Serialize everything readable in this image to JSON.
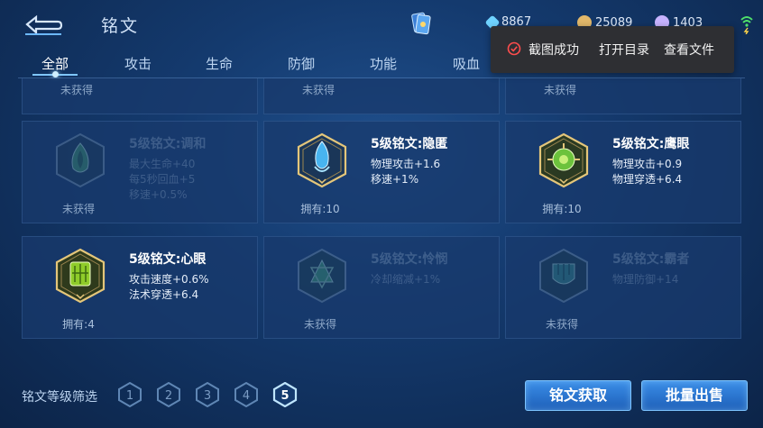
{
  "header": {
    "title": "铭文",
    "currency": [
      {
        "icon": "diamond-icon",
        "value": "8867",
        "color": "#6fd3ff"
      },
      {
        "icon": "gold-coin-icon",
        "value": "25089",
        "color": "#e2b86a"
      },
      {
        "icon": "gem-icon",
        "value": "1403",
        "color": "#c7b3ff"
      }
    ]
  },
  "tabs": [
    "全部",
    "攻击",
    "生命",
    "防御",
    "功能",
    "吸血"
  ],
  "toast": {
    "message": "截图成功",
    "open_dir": "打开目录",
    "view_file": "查看文件"
  },
  "top_partial": [
    "未获得",
    "未获得",
    "未获得"
  ],
  "cards": [
    {
      "name": "5级铭文:调和",
      "attrs": [
        "最大生命+40",
        "每5秒回血+5",
        "移速+0.5%"
      ],
      "status": "未获得",
      "owned": false,
      "color": "#4aa86a"
    },
    {
      "name": "5级铭文:隐匿",
      "attrs": [
        "物理攻击+1.6",
        "移速+1%"
      ],
      "status": "拥有:10",
      "owned": true,
      "color": "#48b4f0"
    },
    {
      "name": "5级铭文:鹰眼",
      "attrs": [
        "物理攻击+0.9",
        "物理穿透+6.4"
      ],
      "status": "拥有:10",
      "owned": true,
      "color": "#6cc23c"
    },
    {
      "name": "5级铭文:心眼",
      "attrs": [
        "攻击速度+0.6%",
        "法术穿透+6.4"
      ],
      "status": "拥有:4",
      "owned": true,
      "color": "#8fcc2a"
    },
    {
      "name": "5级铭文:怜悯",
      "attrs": [
        "冷却缩减+1%"
      ],
      "status": "未获得",
      "owned": false,
      "color": "#48b070"
    },
    {
      "name": "5级铭文:霸者",
      "attrs": [
        "物理防御+14"
      ],
      "status": "未获得",
      "owned": false,
      "color": "#3c9a8a"
    }
  ],
  "filter": {
    "label": "铭文等级筛选",
    "levels": [
      "1",
      "2",
      "3",
      "4",
      "5"
    ],
    "selected": "5"
  },
  "buttons": {
    "obtain": "铭文获取",
    "sell": "批量出售"
  }
}
